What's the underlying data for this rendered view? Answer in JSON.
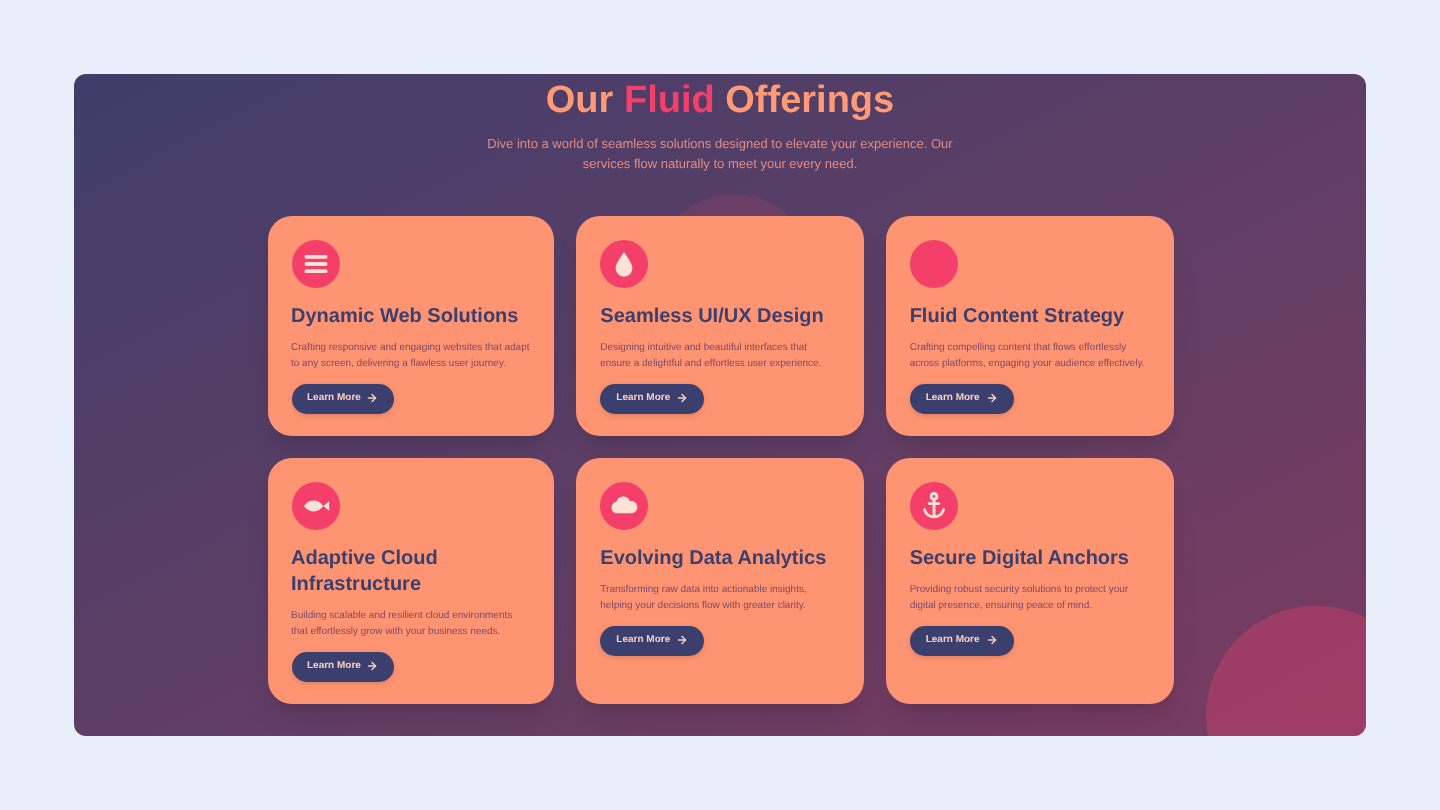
{
  "heading": {
    "before": "Our",
    "highlight": "Fluid",
    "after": "Offerings"
  },
  "subtitle": "Dive into a world of seamless solutions designed to elevate your experience. Our services flow naturally to meet your every need.",
  "cards": [
    {
      "title": "Dynamic Web Solutions",
      "text": "Crafting responsive and engaging websites that adapt to any screen, delivering a flawless user journey.",
      "button": "Learn More"
    },
    {
      "title": "Seamless UI/UX Design",
      "text": "Designing intuitive and beautiful interfaces that ensure a delightful and effortless user experience.",
      "button": "Learn More"
    },
    {
      "title": "Fluid Content Strategy",
      "text": "Crafting compelling content that flows effortlessly across platforms, engaging your audience effectively.",
      "button": "Learn More"
    },
    {
      "title": "Adaptive Cloud Infrastructure",
      "text": "Building scalable and resilient cloud environments that effortlessly grow with your business needs.",
      "button": "Learn More"
    },
    {
      "title": "Evolving Data Analytics",
      "text": "Transforming raw data into actionable insights, helping your decisions flow with greater clarity.",
      "button": "Learn More"
    },
    {
      "title": "Secure Digital Anchors",
      "text": "Providing robust security solutions to protect your digital presence, ensuring peace of mind.",
      "button": "Learn More"
    }
  ]
}
